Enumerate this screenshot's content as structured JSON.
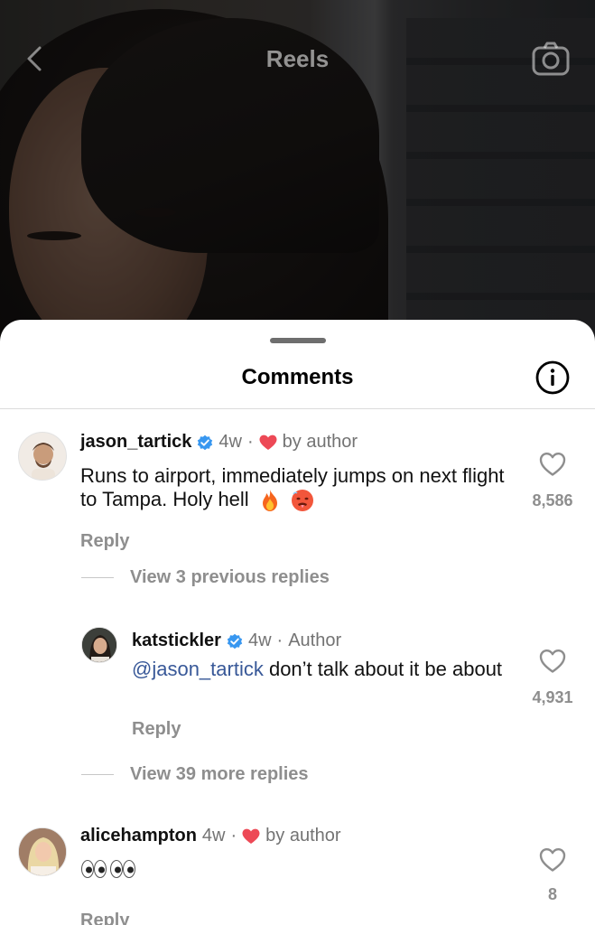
{
  "header": {
    "title": "Reels",
    "back_icon": "chevron-left-icon",
    "camera_icon": "camera-icon"
  },
  "sheet": {
    "title": "Comments",
    "info_icon": "info-icon"
  },
  "comments": [
    {
      "username": "jason_tartick",
      "verified": true,
      "time": "4w",
      "separator": "·",
      "badge": "by author",
      "text": "Runs to airport, immediately jumps on next flight to Tampa. Holy hell",
      "emojis": [
        "fire-emoji",
        "hot-face-emoji"
      ],
      "reply_label": "Reply",
      "likes": "8,586"
    },
    {
      "username": "katstickler",
      "verified": true,
      "time": "4w",
      "separator": "·",
      "badge": "Author",
      "mention": "@jason_tartick",
      "text": " don’t talk about it be about",
      "reply_label": "Reply",
      "likes": "4,931"
    },
    {
      "username": "alicehampton",
      "verified": false,
      "time": "4w",
      "separator": "·",
      "badge": "by author",
      "emojis": [
        "eyes-emoji",
        "eyes-emoji"
      ],
      "reply_label": "Reply",
      "likes": "8"
    }
  ],
  "view_previous": "View 3 previous replies",
  "view_more": "View 39 more replies",
  "colors": {
    "verified": "#3897f0",
    "heart": "#ed4956",
    "mention": "#385898",
    "muted": "#8e8e8e"
  }
}
